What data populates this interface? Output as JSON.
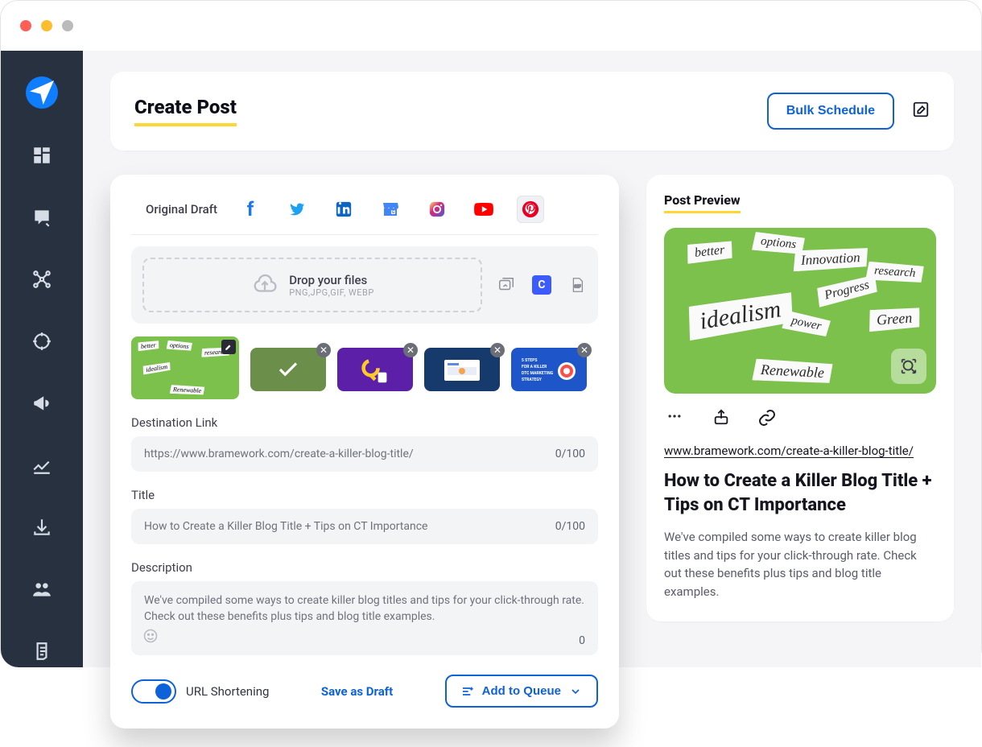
{
  "page": {
    "title": "Create Post",
    "bulk_button": "Bulk Schedule"
  },
  "editor": {
    "original_draft_tab": "Original Draft",
    "dropzone": {
      "line1": "Drop your files",
      "line2": "PNG,JPG,GIF, WEBP"
    },
    "fields": {
      "destination_label": "Destination Link",
      "destination_value": "https://www.bramework.com/create-a-killer-blog-title/",
      "destination_counter": "0/100",
      "title_label": "Title",
      "title_value": "How to Create a Killer Blog Title + Tips on CT Importance",
      "title_counter": "0/100",
      "description_label": "Description",
      "description_value": "We've compiled some ways to create killer blog titles and tips for your click-through rate. Check out these benefits plus tips and blog title examples.",
      "description_counter": "0"
    },
    "footer": {
      "toggle_label": "URL Shortening",
      "save_draft": "Save as Draft",
      "queue": "Add to Queue"
    }
  },
  "preview": {
    "caption": "Post Preview",
    "link": "www.bramework.com/create-a-killer-blog-title/",
    "headline": "How to Create a Killer Blog Title + Tips on CT Importance",
    "description": "We've compiled some ways to create killer blog titles and tips for your click-through rate. Check out these benefits plus tips and blog title examples.",
    "words": {
      "w1": "better",
      "w2": "options",
      "w3": "Innovation",
      "w4": "research",
      "w5": "idealism",
      "w6": "Progress",
      "w7": "power",
      "w8": "Green",
      "w9": "Renewable"
    }
  }
}
